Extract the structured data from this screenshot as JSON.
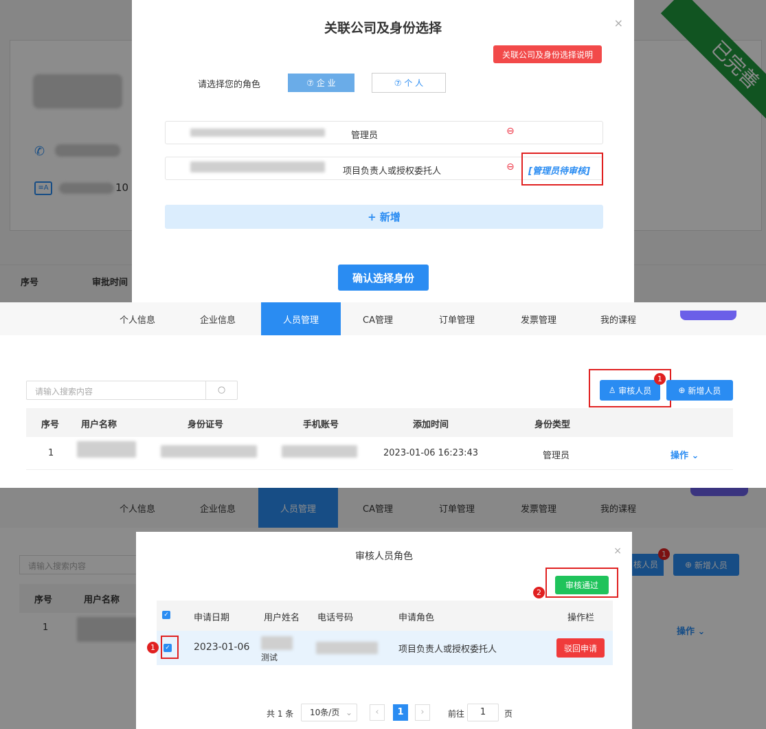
{
  "panel1": {
    "bg_page": {
      "seq": "序号",
      "approval_time": "审批时间",
      "partial_digits": "10",
      "status_ribbon": "已完善"
    },
    "modal": {
      "title": "关联公司及身份选择",
      "help_button": "关联公司及身份选择说明",
      "role_label": "请选择您的角色",
      "role_enterprise": "⑦ 企 业",
      "role_personal": "⑦ 个 人",
      "rows": [
        {
          "role": "管理员",
          "status": ""
        },
        {
          "role": "项目负责人或授权委托人",
          "status": "[管理员待审核]"
        }
      ],
      "add_button": "+ 新增",
      "confirm_button": "确认选择身份"
    }
  },
  "panel2": {
    "nav": [
      "个人信息",
      "企业信息",
      "人员管理",
      "CA管理",
      "订单管理",
      "发票管理",
      "我的课程"
    ],
    "search_placeholder": "请输入搜索内容",
    "review_button": "审核人员",
    "add_person_button": "新增人员",
    "badge": "1",
    "table": {
      "headers": [
        "序号",
        "用户名称",
        "身份证号",
        "手机账号",
        "添加时间",
        "身份类型"
      ],
      "row": {
        "seq": "1",
        "time": "2023-01-06 16:23:43",
        "type": "管理员",
        "action": "操作"
      }
    }
  },
  "panel3": {
    "nav": [
      "个人信息",
      "企业信息",
      "人员管理",
      "CA管理",
      "订单管理",
      "发票管理",
      "我的课程"
    ],
    "search_placeholder": "请输入搜索内容",
    "bg_headers": [
      "序号",
      "用户名称"
    ],
    "bg_seq": "1",
    "bg_action": "操作",
    "bg_review_fragment": "核人员",
    "bg_add": "新增人员",
    "modal": {
      "title": "审核人员角色",
      "approve_button": "审核通过",
      "headers": [
        "申请日期",
        "用户姓名",
        "电话号码",
        "申请角色",
        "操作栏"
      ],
      "row": {
        "date": "2023-01-06",
        "name_fragment": "测试",
        "role": "项目负责人或授权委托人",
        "reject": "驳回申请"
      },
      "pagination": {
        "total": "共 1 条",
        "per_page": "10条/页",
        "page": "1",
        "goto": "前往",
        "goto_value": "1",
        "page_unit": "页"
      }
    },
    "step_badges": [
      "1",
      "2"
    ]
  }
}
